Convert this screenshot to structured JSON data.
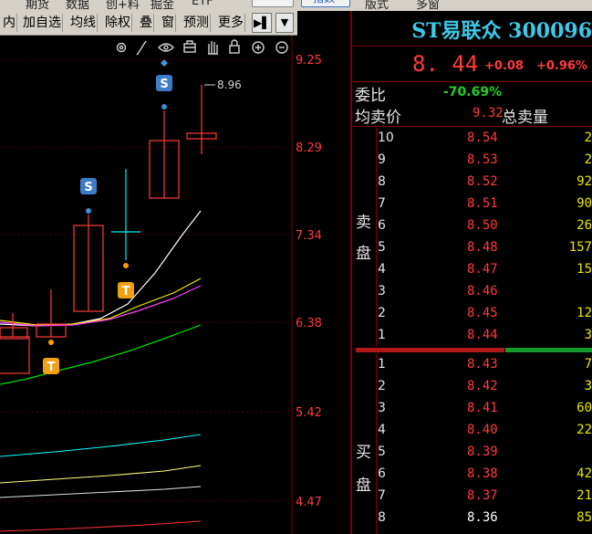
{
  "top_menu": {
    "items": [
      "期货",
      "数据",
      "创+料",
      "掘金",
      "ETF",
      "指数",
      "版式",
      "多窗"
    ]
  },
  "toolbar": {
    "items": [
      "内",
      "加自选",
      "均线",
      "除权",
      "叠",
      "窗",
      "预测",
      "更多"
    ],
    "more_arrow": "▶▌"
  },
  "chart": {
    "price_ticks": [
      "9.25",
      "8.29",
      "7.34",
      "6.38",
      "5.42",
      "4.47"
    ],
    "high_label": "8.96",
    "markers": {
      "s": "S",
      "t": "T"
    },
    "colors": {
      "up": "#ff3b3b",
      "down": "#00cccc",
      "ma_white": "#ffffff",
      "ma_yellow": "#ffff00",
      "ma_magenta": "#ff40ff",
      "ma_green": "#00ff00",
      "ma_cyan": "#00ffff"
    }
  },
  "quote": {
    "title": "ST易联众 300096",
    "price": "8. 44",
    "change": "+0.08",
    "change_pct": "+0.96%",
    "weibi_label": "委比",
    "weibi_value": "-70.69%",
    "avg_sell_label": "均卖价",
    "avg_sell_value": "9.32",
    "total_sell_label": "总卖量",
    "sell_side_label": [
      "卖",
      "盘"
    ],
    "buy_side_label": [
      "买",
      "盘"
    ],
    "sell_orders": [
      {
        "level": "10",
        "price": "8.54",
        "volume": "2"
      },
      {
        "level": "9",
        "price": "8.53",
        "volume": "2"
      },
      {
        "level": "8",
        "price": "8.52",
        "volume": "92"
      },
      {
        "level": "7",
        "price": "8.51",
        "volume": "90"
      },
      {
        "level": "6",
        "price": "8.50",
        "volume": "26"
      },
      {
        "level": "5",
        "price": "8.48",
        "volume": "157"
      },
      {
        "level": "4",
        "price": "8.47",
        "volume": "15"
      },
      {
        "level": "3",
        "price": "8.46",
        "volume": ""
      },
      {
        "level": "2",
        "price": "8.45",
        "volume": "12"
      },
      {
        "level": "1",
        "price": "8.44",
        "volume": "3"
      }
    ],
    "buy_orders": [
      {
        "level": "1",
        "price": "8.43",
        "volume": "7"
      },
      {
        "level": "2",
        "price": "8.42",
        "volume": "3"
      },
      {
        "level": "3",
        "price": "8.41",
        "volume": "60"
      },
      {
        "level": "4",
        "price": "8.40",
        "volume": "22"
      },
      {
        "level": "5",
        "price": "8.39",
        "volume": ""
      },
      {
        "level": "6",
        "price": "8.38",
        "volume": "42"
      },
      {
        "level": "7",
        "price": "8.37",
        "volume": "21"
      },
      {
        "level": "8",
        "price": "8.36",
        "volume": "85"
      }
    ]
  }
}
